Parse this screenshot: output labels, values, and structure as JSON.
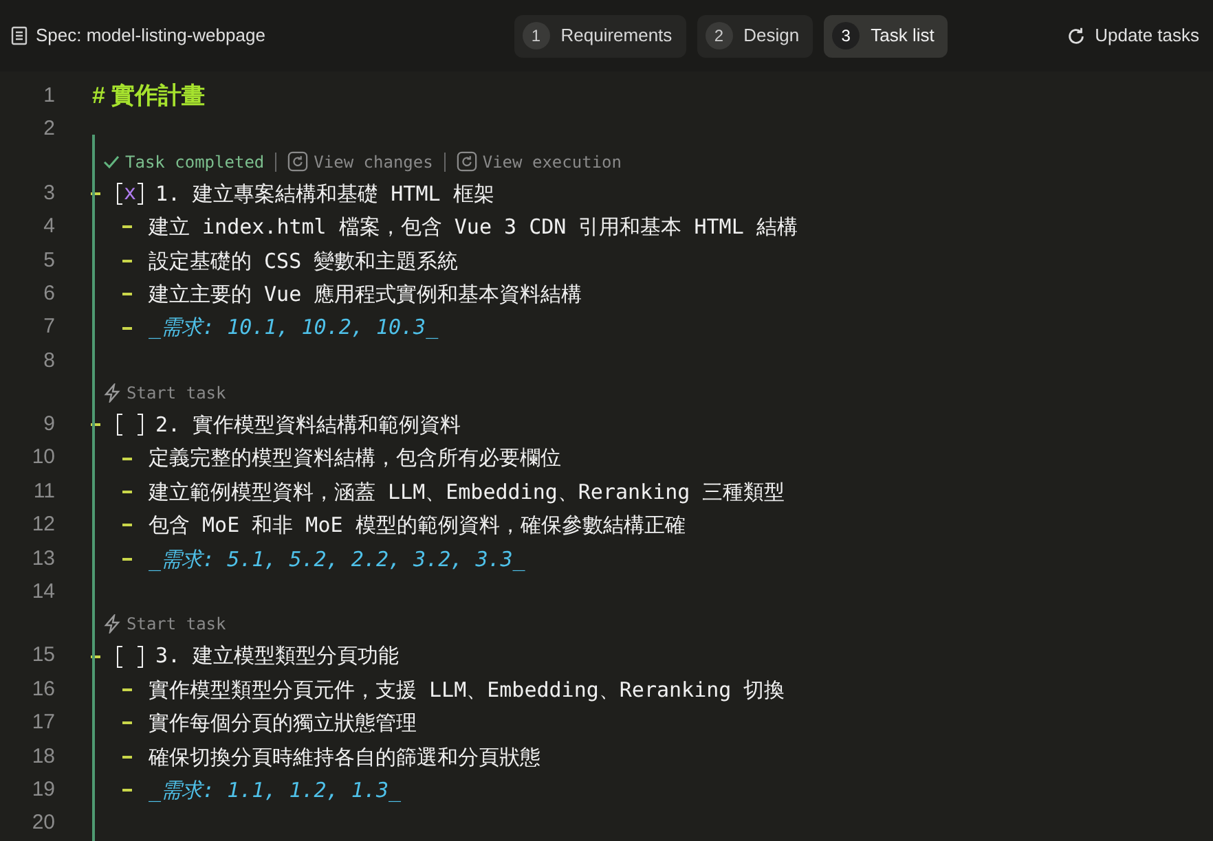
{
  "header": {
    "spec_title": "Spec: model-listing-webpage",
    "update_button": "Update tasks"
  },
  "tabs": [
    {
      "number": "1",
      "label": "Requirements",
      "selected": false
    },
    {
      "number": "2",
      "label": "Design",
      "selected": false
    },
    {
      "number": "3",
      "label": "Task list",
      "selected": true
    }
  ],
  "editor": {
    "lines": [
      {
        "kind": "heading",
        "number": "1",
        "text": "# 實作計畫"
      },
      {
        "kind": "blank",
        "number": "2"
      },
      {
        "kind": "completed",
        "status_text": "Task completed",
        "actions": [
          "View changes",
          "View execution"
        ]
      },
      {
        "kind": "task",
        "number": "3",
        "checked": true,
        "mark": "x",
        "text": "1. 建立專案結構和基礎 HTML 框架"
      },
      {
        "kind": "item",
        "number": "4",
        "text": "建立 index.html 檔案，包含 Vue 3 CDN 引用和基本 HTML 結構"
      },
      {
        "kind": "item",
        "number": "5",
        "text": "設定基礎的 CSS 變數和主題系統"
      },
      {
        "kind": "item",
        "number": "6",
        "text": "建立主要的 Vue 應用程式實例和基本資料結構"
      },
      {
        "kind": "requirement",
        "number": "7",
        "text": "_需求: 10.1, 10.2, 10.3_"
      },
      {
        "kind": "blank",
        "number": "8"
      },
      {
        "kind": "start",
        "status_text": "Start task"
      },
      {
        "kind": "task",
        "number": "9",
        "checked": false,
        "text": "2. 實作模型資料結構和範例資料"
      },
      {
        "kind": "item",
        "number": "10",
        "text": "定義完整的模型資料結構，包含所有必要欄位"
      },
      {
        "kind": "item",
        "number": "11",
        "text": "建立範例模型資料，涵蓋 LLM、Embedding、Reranking 三種類型"
      },
      {
        "kind": "item",
        "number": "12",
        "text": "包含 MoE 和非 MoE 模型的範例資料，確保參數結構正確"
      },
      {
        "kind": "requirement",
        "number": "13",
        "text": "_需求: 5.1, 5.2, 2.2, 3.2, 3.3_"
      },
      {
        "kind": "blank",
        "number": "14"
      },
      {
        "kind": "start",
        "status_text": "Start task"
      },
      {
        "kind": "task",
        "number": "15",
        "checked": false,
        "text": "3. 建立模型類型分頁功能"
      },
      {
        "kind": "item",
        "number": "16",
        "text": "實作模型類型分頁元件，支援 LLM、Embedding、Reranking 切換"
      },
      {
        "kind": "item",
        "number": "17",
        "text": "實作每個分頁的獨立狀態管理"
      },
      {
        "kind": "item",
        "number": "18",
        "text": "確保切換分頁時維持各自的篩選和分頁狀態"
      },
      {
        "kind": "requirement",
        "number": "19",
        "text": "_需求: 1.1, 1.2, 1.3_"
      },
      {
        "kind": "blank",
        "number": "20"
      }
    ]
  }
}
